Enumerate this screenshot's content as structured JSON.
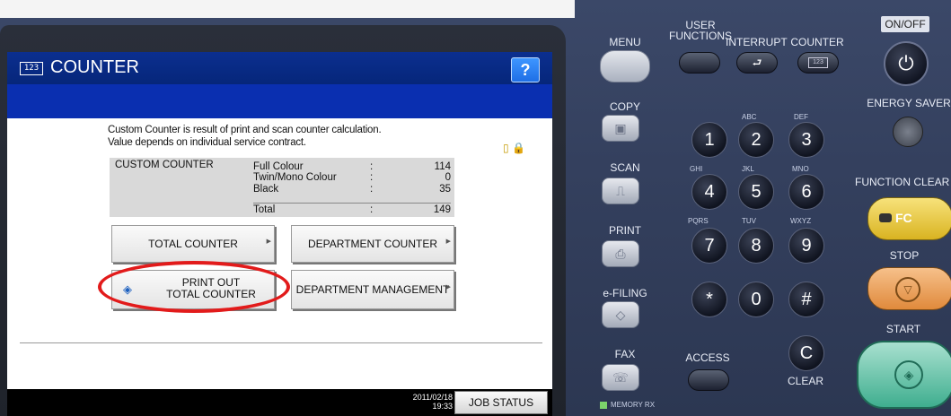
{
  "screen": {
    "title": "COUNTER",
    "title_icon": "123",
    "help": "?",
    "description": [
      "Custom Counter is result of print and scan counter calculation.",
      "Value depends on individual service contract."
    ],
    "counter_table": {
      "label": "CUSTOM COUNTER",
      "rows": [
        {
          "name": "Full Colour",
          "sep": ":",
          "value": "114"
        },
        {
          "name": "Twin/Mono Colour",
          "sep": ":",
          "value": "0"
        },
        {
          "name": "Black",
          "sep": ":",
          "value": "35"
        }
      ],
      "total": {
        "name": "Total",
        "sep": ":",
        "value": "149"
      }
    },
    "buttons": {
      "total_counter": "TOTAL COUNTER",
      "department_counter": "DEPARTMENT COUNTER",
      "print_out_line1": "PRINT OUT",
      "print_out_line2": "TOTAL COUNTER",
      "department_management": "DEPARTMENT MANAGEMENT"
    },
    "date": "2011/02/18",
    "time": "19:33",
    "job_status": "JOB STATUS"
  },
  "panel": {
    "menu": "MENU",
    "user_functions_1": "USER",
    "user_functions_2": "FUNCTIONS",
    "interrupt": "INTERRUPT",
    "counter": "COUNTER",
    "counter_icon": "123",
    "on_off": "ON/OFF",
    "energy_saver": "ENERGY SAVER",
    "copy": "COPY",
    "scan": "SCAN",
    "print": "PRINT",
    "efiling": "e-FILING",
    "fax": "FAX",
    "memory_rx": "MEMORY RX",
    "access": "ACCESS",
    "clear": "CLEAR",
    "function_clear": "FUNCTION CLEAR",
    "fc": "FC",
    "stop": "STOP",
    "start": "START",
    "keys": [
      {
        "digit": "1",
        "letters": ""
      },
      {
        "digit": "2",
        "letters": "ABC"
      },
      {
        "digit": "3",
        "letters": "DEF"
      },
      {
        "digit": "4",
        "letters": "GHI"
      },
      {
        "digit": "5",
        "letters": "JKL"
      },
      {
        "digit": "6",
        "letters": "MNO"
      },
      {
        "digit": "7",
        "letters": "PQRS"
      },
      {
        "digit": "8",
        "letters": "TUV"
      },
      {
        "digit": "9",
        "letters": "WXYZ"
      },
      {
        "digit": "*",
        "letters": ""
      },
      {
        "digit": "0",
        "letters": ""
      },
      {
        "digit": "#",
        "letters": ""
      },
      {
        "digit": "C",
        "letters": ""
      }
    ]
  },
  "colors": {
    "highlight_oval": "#e21b1b",
    "title_bar": "#0b2f8f",
    "help_button": "#1f6fe6"
  }
}
